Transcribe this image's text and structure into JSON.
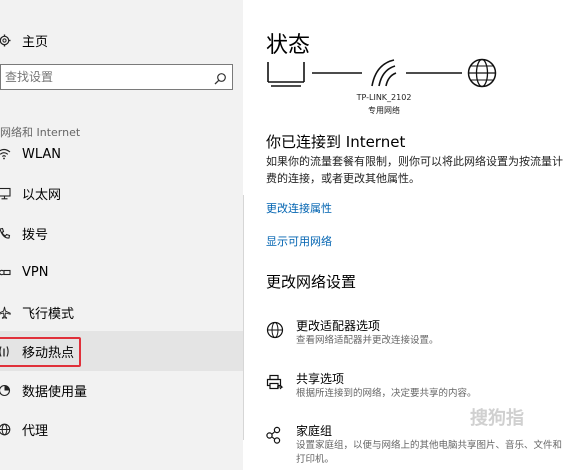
{
  "sidebar": {
    "home_label": "主页",
    "search_placeholder": "查找设置",
    "section_label": "网络和 Internet",
    "items": [
      {
        "label": "WLAN"
      },
      {
        "label": "以太网"
      },
      {
        "label": "拨号"
      },
      {
        "label": "VPN"
      },
      {
        "label": "飞行模式"
      },
      {
        "label": "移动热点"
      },
      {
        "label": "数据使用量"
      },
      {
        "label": "代理"
      }
    ]
  },
  "main": {
    "title": "状态",
    "network_name": "TP-LINK_2102",
    "network_type": "专用网络",
    "connected_heading": "你已连接到 Internet",
    "connected_desc_line1": "如果你的流量套餐有限制，则你可以将此网络设置为按流量计",
    "connected_desc_line2": "费的连接，或者更改其他属性。",
    "link_change_props": "更改连接属性",
    "link_show_networks": "显示可用网络",
    "change_settings_heading": "更改网络设置",
    "options": [
      {
        "title": "更改适配器选项",
        "desc1": "查看网络适配器并更改连接设置。",
        "desc2": ""
      },
      {
        "title": "共享选项",
        "desc1": "根据所连接到的网络，决定要共享的内容。",
        "desc2": ""
      },
      {
        "title": "家庭组",
        "desc1": "设置家庭组，以便与网络上的其他电脑共享图片、音乐、文件和",
        "desc2": "打印机。"
      }
    ]
  },
  "watermark": "搜狗指"
}
